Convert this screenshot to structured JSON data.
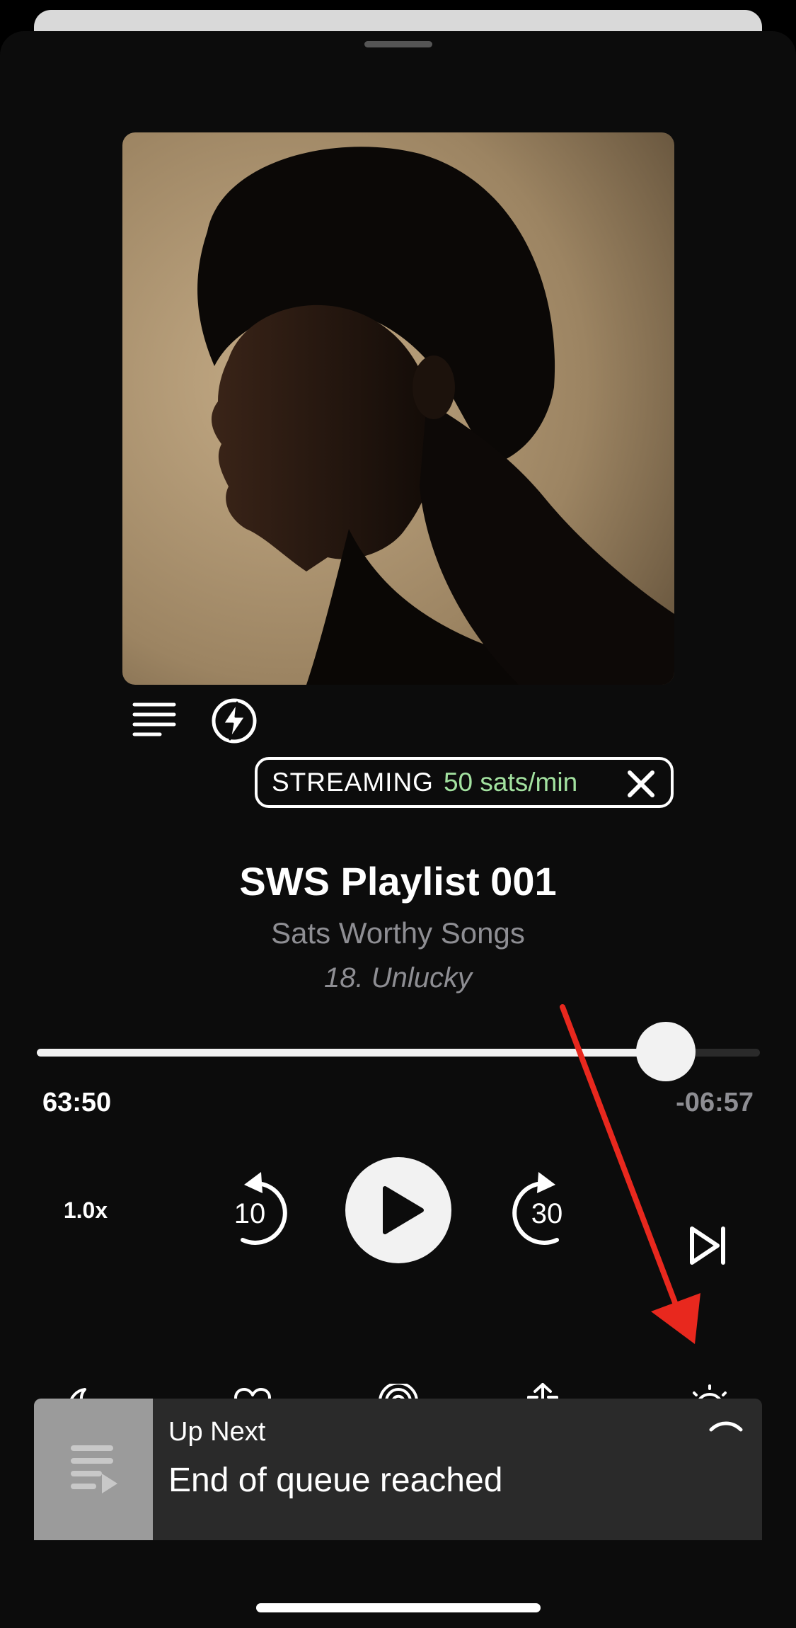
{
  "player": {
    "streaming_label": "STREAMING",
    "streaming_rate": "50 sats/min",
    "title": "SWS Playlist 001",
    "subtitle": "Sats Worthy Songs",
    "episode": "18. Unlucky",
    "progress_fraction": 0.87,
    "time_elapsed": "63:50",
    "time_remaining": "-06:57",
    "speed": "1.0x",
    "skip_back": "10",
    "skip_forward": "30"
  },
  "up_next": {
    "label": "Up Next",
    "message": "End of queue reached"
  },
  "colors": {
    "background": "#0c0c0c",
    "rate_green": "#a3e2a0",
    "annotation_arrow": "#e8281e"
  },
  "icons": [
    "chapters-icon",
    "lightning-icon",
    "close-icon",
    "skip-back-icon",
    "play-icon",
    "skip-forward-icon",
    "next-track-icon",
    "sleep-timer-icon",
    "heart-icon",
    "airplay-icon",
    "share-icon",
    "effects-dial-icon",
    "queue-icon",
    "chevron-up-icon"
  ]
}
